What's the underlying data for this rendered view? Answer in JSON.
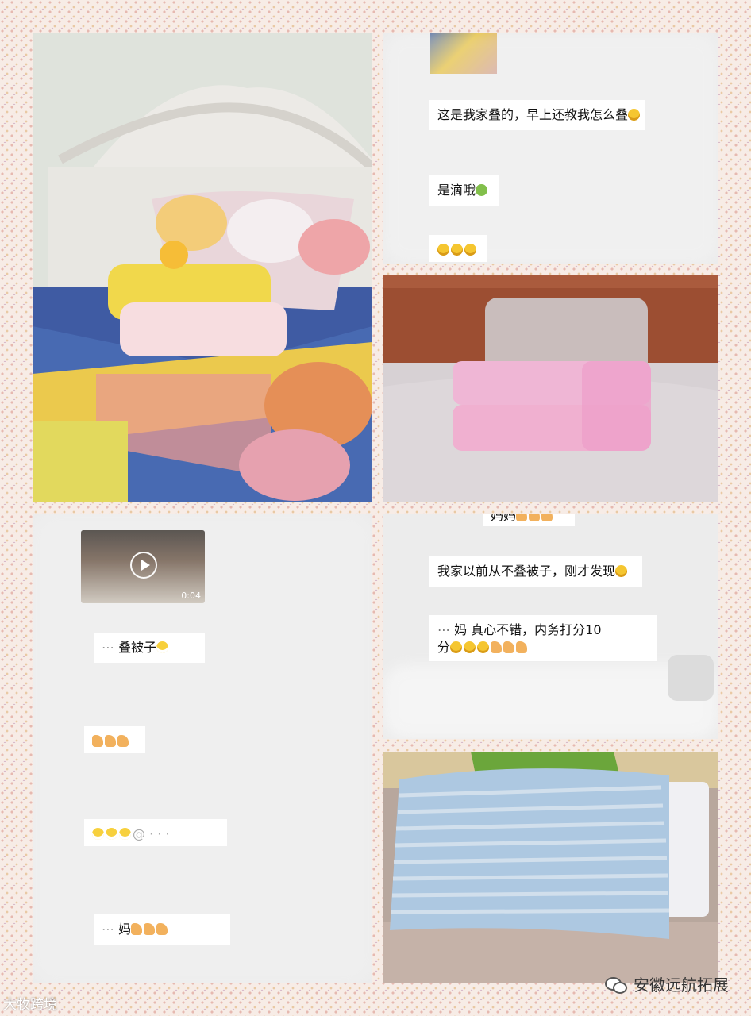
{
  "chat_top": {
    "msg1": "这是我家叠的，早上还教我怎么叠",
    "msg2": "是滴哦"
  },
  "chat_left": {
    "video_duration": "0:04",
    "msg1": "叠被子",
    "msg2": "妈"
  },
  "chat_right": {
    "top_partial": "妈妈",
    "msg1": "我家以前从不叠被子，刚才发现",
    "msg2_line1": "妈 真心不错，内务打分10",
    "msg2_line2": "分"
  },
  "watermarks": {
    "left": "大牧跨境",
    "right": "安徽远航拓展"
  },
  "icons": [
    "play-icon",
    "wechat-icon",
    "thumb-icon",
    "grin-icon",
    "smile-icon"
  ]
}
